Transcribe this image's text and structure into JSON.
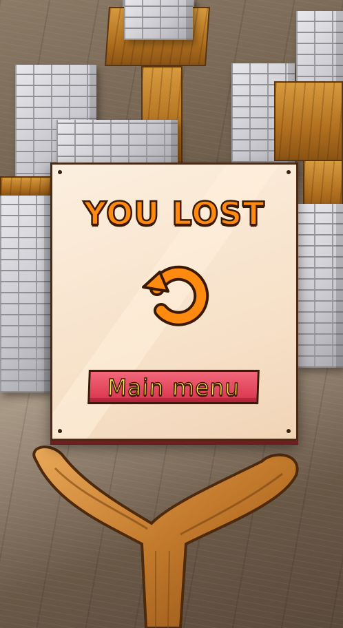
{
  "game_over": {
    "title": "YOU LOST",
    "retry_icon": "retry-arrow-icon",
    "main_menu_label": "Main menu"
  },
  "colors": {
    "title_fill": "#ff8a10",
    "button_fill": "#e2445b",
    "button_text": "#ffe54a",
    "card_bg": "#fbe8d4",
    "outline": "#3a1a05"
  }
}
